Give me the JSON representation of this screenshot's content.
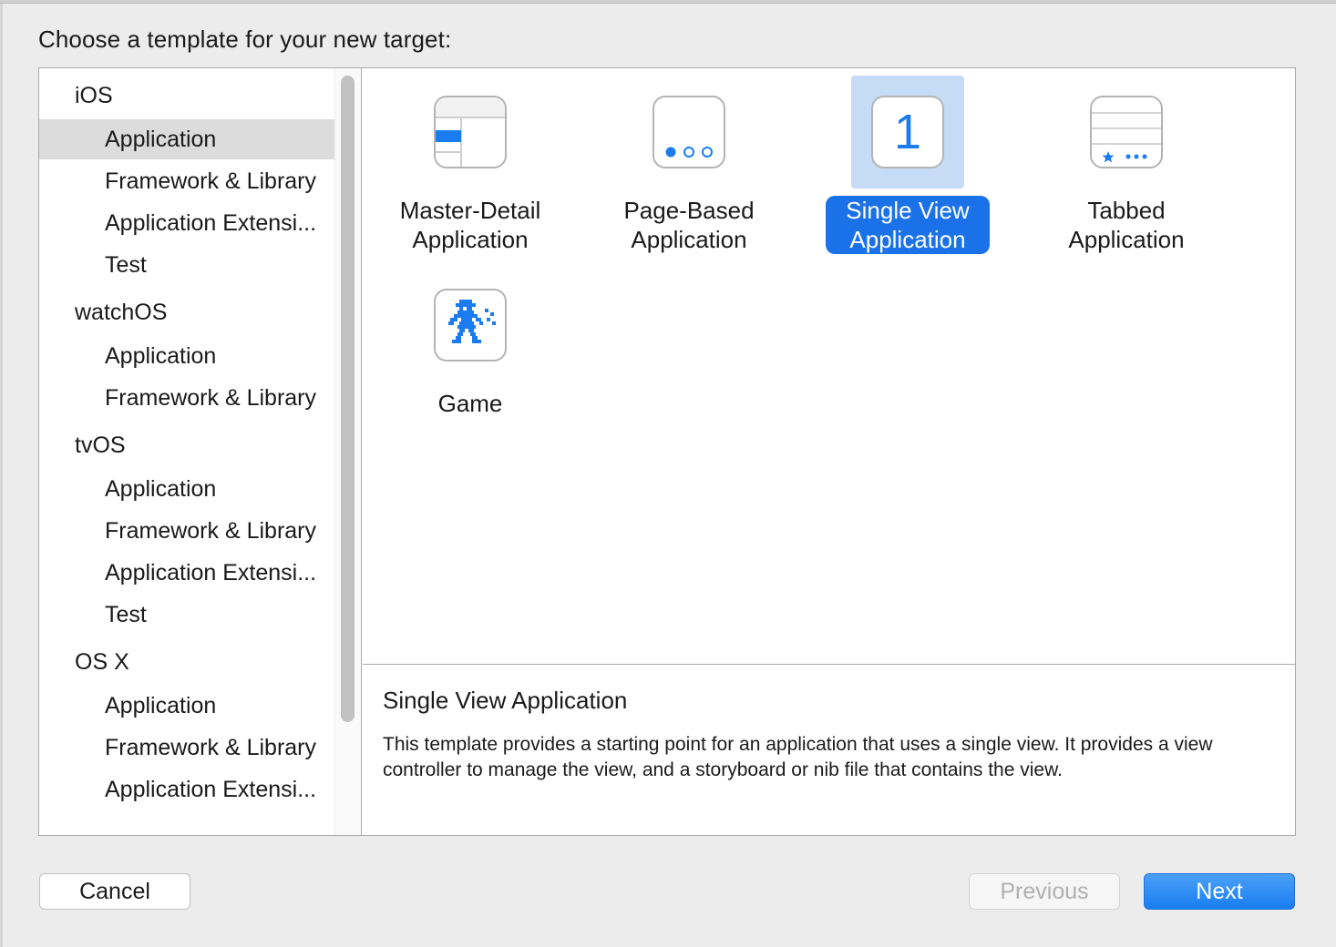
{
  "dialog": {
    "heading": "Choose a template for your new target:"
  },
  "sidebar": {
    "rows": [
      {
        "label": "iOS",
        "kind": "group"
      },
      {
        "label": "Application",
        "kind": "item",
        "selected": true
      },
      {
        "label": "Framework & Library",
        "kind": "item"
      },
      {
        "label": "Application Extensi...",
        "kind": "item"
      },
      {
        "label": "Test",
        "kind": "item"
      },
      {
        "label": "watchOS",
        "kind": "group"
      },
      {
        "label": "Application",
        "kind": "item"
      },
      {
        "label": "Framework & Library",
        "kind": "item"
      },
      {
        "label": "tvOS",
        "kind": "group"
      },
      {
        "label": "Application",
        "kind": "item"
      },
      {
        "label": "Framework & Library",
        "kind": "item"
      },
      {
        "label": "Application Extensi...",
        "kind": "item"
      },
      {
        "label": "Test",
        "kind": "item"
      },
      {
        "label": "OS X",
        "kind": "group"
      },
      {
        "label": "Application",
        "kind": "item"
      },
      {
        "label": "Framework & Library",
        "kind": "item"
      },
      {
        "label": "Application Extensi...",
        "kind": "item"
      }
    ]
  },
  "templates": [
    {
      "line1": "Master-Detail",
      "line2": "Application",
      "icon": "master-detail-icon"
    },
    {
      "line1": "Page-Based",
      "line2": "Application",
      "icon": "page-dots-icon"
    },
    {
      "line1": "Single View",
      "line2": "Application",
      "icon": "single-view-icon",
      "icon_text": "1",
      "selected": true
    },
    {
      "line1": "Tabbed",
      "line2": "Application",
      "icon": "tab-bar-icon"
    },
    {
      "line1": "Game",
      "line2": "",
      "icon": "game-sprite-icon"
    }
  ],
  "description": {
    "title": "Single View Application",
    "body": "This template provides a starting point for an application that uses a single view. It provides a view controller to manage the view, and a storyboard or nib file that contains the view."
  },
  "buttons": {
    "cancel": "Cancel",
    "previous": "Previous",
    "next": "Next"
  },
  "colors": {
    "accent": "#1b72e8",
    "icon_blue": "#1b7cf2",
    "selection_bg": "#c6dbf5",
    "sidebar_selected": "#dcdcdc"
  }
}
